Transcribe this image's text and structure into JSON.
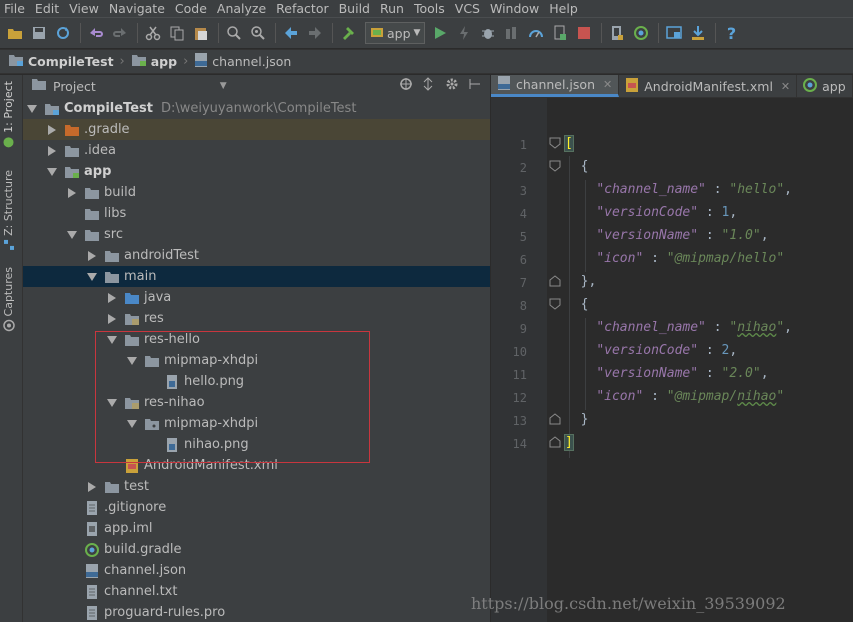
{
  "menu": [
    "File",
    "Edit",
    "View",
    "Navigate",
    "Code",
    "Analyze",
    "Refactor",
    "Build",
    "Run",
    "Tools",
    "VCS",
    "Window",
    "Help"
  ],
  "toolbar": {
    "run_config": "app"
  },
  "breadcrumb": {
    "project": "CompileTest",
    "module": "app",
    "file": "channel.json"
  },
  "leftstrip": {
    "tab1": "1: Project",
    "tab2": "Z: Structure",
    "tab3": "Captures"
  },
  "project_panel": {
    "view_selector": "Project"
  },
  "tree": [
    {
      "label": "CompileTest",
      "path": "D:\\weiyuyanwork\\CompileTest",
      "bold": true
    },
    {
      "label": ".gradle"
    },
    {
      "label": ".idea"
    },
    {
      "label": "app",
      "bold": true
    },
    {
      "label": "build"
    },
    {
      "label": "libs"
    },
    {
      "label": "src"
    },
    {
      "label": "androidTest"
    },
    {
      "label": "main"
    },
    {
      "label": "java"
    },
    {
      "label": "res"
    },
    {
      "label": "res-hello"
    },
    {
      "label": "mipmap-xhdpi"
    },
    {
      "label": "hello.png"
    },
    {
      "label": "res-nihao"
    },
    {
      "label": "mipmap-xhdpi"
    },
    {
      "label": "nihao.png"
    },
    {
      "label": "AndroidManifest.xml"
    },
    {
      "label": "test"
    },
    {
      "label": ".gitignore"
    },
    {
      "label": "app.iml"
    },
    {
      "label": "build.gradle"
    },
    {
      "label": "channel.json"
    },
    {
      "label": "channel.txt"
    },
    {
      "label": "proguard-rules.pro"
    }
  ],
  "editor_tabs": [
    {
      "label": "channel.json",
      "active": true
    },
    {
      "label": "AndroidManifest.xml",
      "active": false
    },
    {
      "label": "app",
      "active": false
    }
  ],
  "line_numbers": [
    "1",
    "2",
    "3",
    "4",
    "5",
    "6",
    "7",
    "8",
    "9",
    "10",
    "11",
    "12",
    "13",
    "14"
  ],
  "code": {
    "l1": "[",
    "l2": "{",
    "l3_key": "\"channel_name\"",
    "l3_val": "\"hello\"",
    "l4_key": "\"versionCode\"",
    "l4_val": "1",
    "l5_key": "\"versionName\"",
    "l5_val": "\"1.0\"",
    "l6_key": "\"icon\"",
    "l6_val": "\"@mipmap/hello\"",
    "l7": "},",
    "l8": "{",
    "l9_key": "\"channel_name\"",
    "l9_val_a": "\"",
    "l9_val_b": "nihao",
    "l9_val_c": "\"",
    "l10_key": "\"versionCode\"",
    "l10_val": "2",
    "l11_key": "\"versionName\"",
    "l11_val": "\"2.0\"",
    "l12_key": "\"icon\"",
    "l12_val_a": "\"@mipmap/",
    "l12_val_b": "nihao",
    "l12_val_c": "\"",
    "l13": "}",
    "l14": "]",
    "colon": " : ",
    "comma": ","
  },
  "watermark": "https://blog.csdn.net/weixin_39539092",
  "colors": {
    "selection": "#0d293e",
    "highlight_row": "#4a4636",
    "annotation_box": "#c8363e",
    "tab_underline": "#4a88c7"
  }
}
